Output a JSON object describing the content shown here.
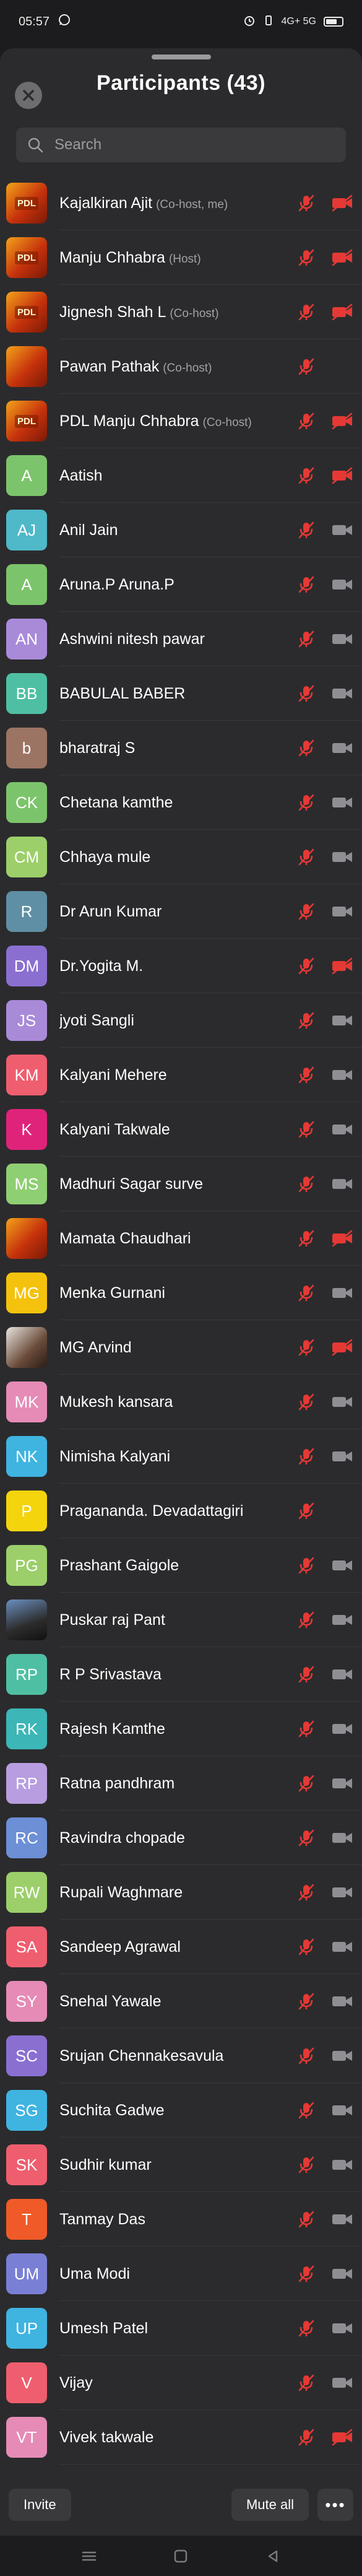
{
  "status_bar": {
    "time": "05:57",
    "signal_text": "4G+ 5G"
  },
  "header": {
    "title": "Participants (43)"
  },
  "search": {
    "placeholder": "Search"
  },
  "colors": {
    "muted_red": "#e53935",
    "icon_grey": "#8e8e93",
    "sheet_bg": "#2b2b2d"
  },
  "participants": [
    {
      "name": "Kajalkiran Ajit",
      "role": "(Co-host, me)",
      "avatar_text": "PDL",
      "avatar_color": "photo",
      "mic_muted": true,
      "video_off": true,
      "video_shown": true
    },
    {
      "name": "Manju Chhabra",
      "role": "(Host)",
      "avatar_text": "PDL",
      "avatar_color": "photo",
      "mic_muted": true,
      "video_off": true,
      "video_shown": true
    },
    {
      "name": "Jignesh Shah L",
      "role": "(Co-host)",
      "avatar_text": "PDL",
      "avatar_color": "photo",
      "mic_muted": true,
      "video_off": true,
      "video_shown": true
    },
    {
      "name": "Pawan Pathak",
      "role": "(Co-host)",
      "avatar_text": "",
      "avatar_color": "photo",
      "mic_muted": true,
      "video_off": false,
      "video_shown": false
    },
    {
      "name": "PDL Manju Chhabra",
      "role": "(Co-host)",
      "avatar_text": "PDL",
      "avatar_color": "photo",
      "mic_muted": true,
      "video_off": true,
      "video_shown": true
    },
    {
      "name": "Aatish",
      "role": "",
      "avatar_text": "A",
      "avatar_color": "#7cc46b",
      "mic_muted": true,
      "video_off": true,
      "video_shown": true
    },
    {
      "name": "Anil Jain",
      "role": "",
      "avatar_text": "AJ",
      "avatar_color": "#4fb8c9",
      "mic_muted": true,
      "video_off": false,
      "video_shown": true
    },
    {
      "name": "Aruna.P Aruna.P",
      "role": "",
      "avatar_text": "A",
      "avatar_color": "#7cc46b",
      "mic_muted": true,
      "video_off": false,
      "video_shown": true
    },
    {
      "name": "Ashwini nitesh pawar",
      "role": "",
      "avatar_text": "AN",
      "avatar_color": "#a98ad9",
      "mic_muted": true,
      "video_off": false,
      "video_shown": true
    },
    {
      "name": "BABULAL BABER",
      "role": "",
      "avatar_text": "BB",
      "avatar_color": "#4fbfa3",
      "mic_muted": true,
      "video_off": false,
      "video_shown": true
    },
    {
      "name": "bharatraj S",
      "role": "",
      "avatar_text": "b",
      "avatar_color": "#9c7463",
      "mic_muted": true,
      "video_off": false,
      "video_shown": true
    },
    {
      "name": "Chetana kamthe",
      "role": "",
      "avatar_text": "CK",
      "avatar_color": "#7cc46b",
      "mic_muted": true,
      "video_off": false,
      "video_shown": true
    },
    {
      "name": "Chhaya mule",
      "role": "",
      "avatar_text": "CM",
      "avatar_color": "#9ccf6a",
      "mic_muted": true,
      "video_off": false,
      "video_shown": true
    },
    {
      "name": "Dr Arun Kumar",
      "role": "",
      "avatar_text": "R",
      "avatar_color": "#5f8fa4",
      "mic_muted": true,
      "video_off": false,
      "video_shown": true
    },
    {
      "name": "Dr.Yogita M.",
      "role": "",
      "avatar_text": "DM",
      "avatar_color": "#8a6fd1",
      "mic_muted": true,
      "video_off": true,
      "video_shown": true
    },
    {
      "name": "jyoti Sangli",
      "role": "",
      "avatar_text": "JS",
      "avatar_color": "#a98ad9",
      "mic_muted": true,
      "video_off": false,
      "video_shown": true
    },
    {
      "name": "Kalyani Mehere",
      "role": "",
      "avatar_text": "KM",
      "avatar_color": "#ef5e6e",
      "mic_muted": true,
      "video_off": false,
      "video_shown": true
    },
    {
      "name": "Kalyani Takwale",
      "role": "",
      "avatar_text": "K",
      "avatar_color": "#e0237a",
      "mic_muted": true,
      "video_off": false,
      "video_shown": true
    },
    {
      "name": "Madhuri Sagar surve",
      "role": "",
      "avatar_text": "MS",
      "avatar_color": "#8fcf73",
      "mic_muted": true,
      "video_off": false,
      "video_shown": true
    },
    {
      "name": "Mamata Chaudhari",
      "role": "",
      "avatar_text": "",
      "avatar_color": "photo",
      "mic_muted": true,
      "video_off": true,
      "video_shown": true
    },
    {
      "name": "Menka Gurnani",
      "role": "",
      "avatar_text": "MG",
      "avatar_color": "#f4c20d",
      "mic_muted": true,
      "video_off": false,
      "video_shown": true
    },
    {
      "name": "MG Arvind",
      "role": "",
      "avatar_text": "",
      "avatar_color": "photo2",
      "mic_muted": true,
      "video_off": true,
      "video_shown": true
    },
    {
      "name": "Mukesh kansara",
      "role": "",
      "avatar_text": "MK",
      "avatar_color": "#e58bb6",
      "mic_muted": true,
      "video_off": false,
      "video_shown": true
    },
    {
      "name": "Nimisha Kalyani",
      "role": "",
      "avatar_text": "NK",
      "avatar_color": "#3fb4e0",
      "mic_muted": true,
      "video_off": false,
      "video_shown": true
    },
    {
      "name": "Pragananda.   Devadattagiri",
      "role": "",
      "avatar_text": "P",
      "avatar_color": "#f4d40d",
      "mic_muted": true,
      "video_off": false,
      "video_shown": false
    },
    {
      "name": "Prashant Gaigole",
      "role": "",
      "avatar_text": "PG",
      "avatar_color": "#9ccf6a",
      "mic_muted": true,
      "video_off": false,
      "video_shown": true
    },
    {
      "name": "Puskar raj Pant",
      "role": "",
      "avatar_text": "",
      "avatar_color": "photo3",
      "mic_muted": true,
      "video_off": false,
      "video_shown": true
    },
    {
      "name": "R P Srivastava",
      "role": "",
      "avatar_text": "RP",
      "avatar_color": "#4fbfa3",
      "mic_muted": true,
      "video_off": false,
      "video_shown": true
    },
    {
      "name": "Rajesh Kamthe",
      "role": "",
      "avatar_text": "RK",
      "avatar_color": "#3cb6b6",
      "mic_muted": true,
      "video_off": false,
      "video_shown": true
    },
    {
      "name": "Ratna pandhram",
      "role": "",
      "avatar_text": "RP",
      "avatar_color": "#b89ee0",
      "mic_muted": true,
      "video_off": false,
      "video_shown": true
    },
    {
      "name": "Ravindra chopade",
      "role": "",
      "avatar_text": "RC",
      "avatar_color": "#6c8fd6",
      "mic_muted": true,
      "video_off": false,
      "video_shown": true
    },
    {
      "name": "Rupali Waghmare",
      "role": "",
      "avatar_text": "RW",
      "avatar_color": "#9ccf6a",
      "mic_muted": true,
      "video_off": false,
      "video_shown": true
    },
    {
      "name": "Sandeep Agrawal",
      "role": "",
      "avatar_text": "SA",
      "avatar_color": "#ef5e6e",
      "mic_muted": true,
      "video_off": false,
      "video_shown": true
    },
    {
      "name": "Snehal Yawale",
      "role": "",
      "avatar_text": "SY",
      "avatar_color": "#e58bb6",
      "mic_muted": true,
      "video_off": false,
      "video_shown": true
    },
    {
      "name": "Srujan Chennakesavula",
      "role": "",
      "avatar_text": "SC",
      "avatar_color": "#8a6fd1",
      "mic_muted": true,
      "video_off": false,
      "video_shown": true
    },
    {
      "name": "Suchita Gadwe",
      "role": "",
      "avatar_text": "SG",
      "avatar_color": "#3fb4e0",
      "mic_muted": true,
      "video_off": false,
      "video_shown": true
    },
    {
      "name": "Sudhir kumar",
      "role": "",
      "avatar_text": "SK",
      "avatar_color": "#ef5e6e",
      "mic_muted": true,
      "video_off": false,
      "video_shown": true
    },
    {
      "name": "Tanmay Das",
      "role": "",
      "avatar_text": "T",
      "avatar_color": "#f05a28",
      "mic_muted": true,
      "video_off": false,
      "video_shown": true
    },
    {
      "name": "Uma Modi",
      "role": "",
      "avatar_text": "UM",
      "avatar_color": "#7a7fd6",
      "mic_muted": true,
      "video_off": false,
      "video_shown": true
    },
    {
      "name": "Umesh Patel",
      "role": "",
      "avatar_text": "UP",
      "avatar_color": "#3fb4e0",
      "mic_muted": true,
      "video_off": false,
      "video_shown": true
    },
    {
      "name": "Vijay",
      "role": "",
      "avatar_text": "V",
      "avatar_color": "#ef5e6e",
      "mic_muted": true,
      "video_off": false,
      "video_shown": true
    },
    {
      "name": "Vivek takwale",
      "role": "",
      "avatar_text": "VT",
      "avatar_color": "#e58bb6",
      "mic_muted": true,
      "video_off": true,
      "video_shown": true
    }
  ],
  "footer": {
    "invite_label": "Invite",
    "mute_all_label": "Mute all",
    "more_label": "•••"
  }
}
